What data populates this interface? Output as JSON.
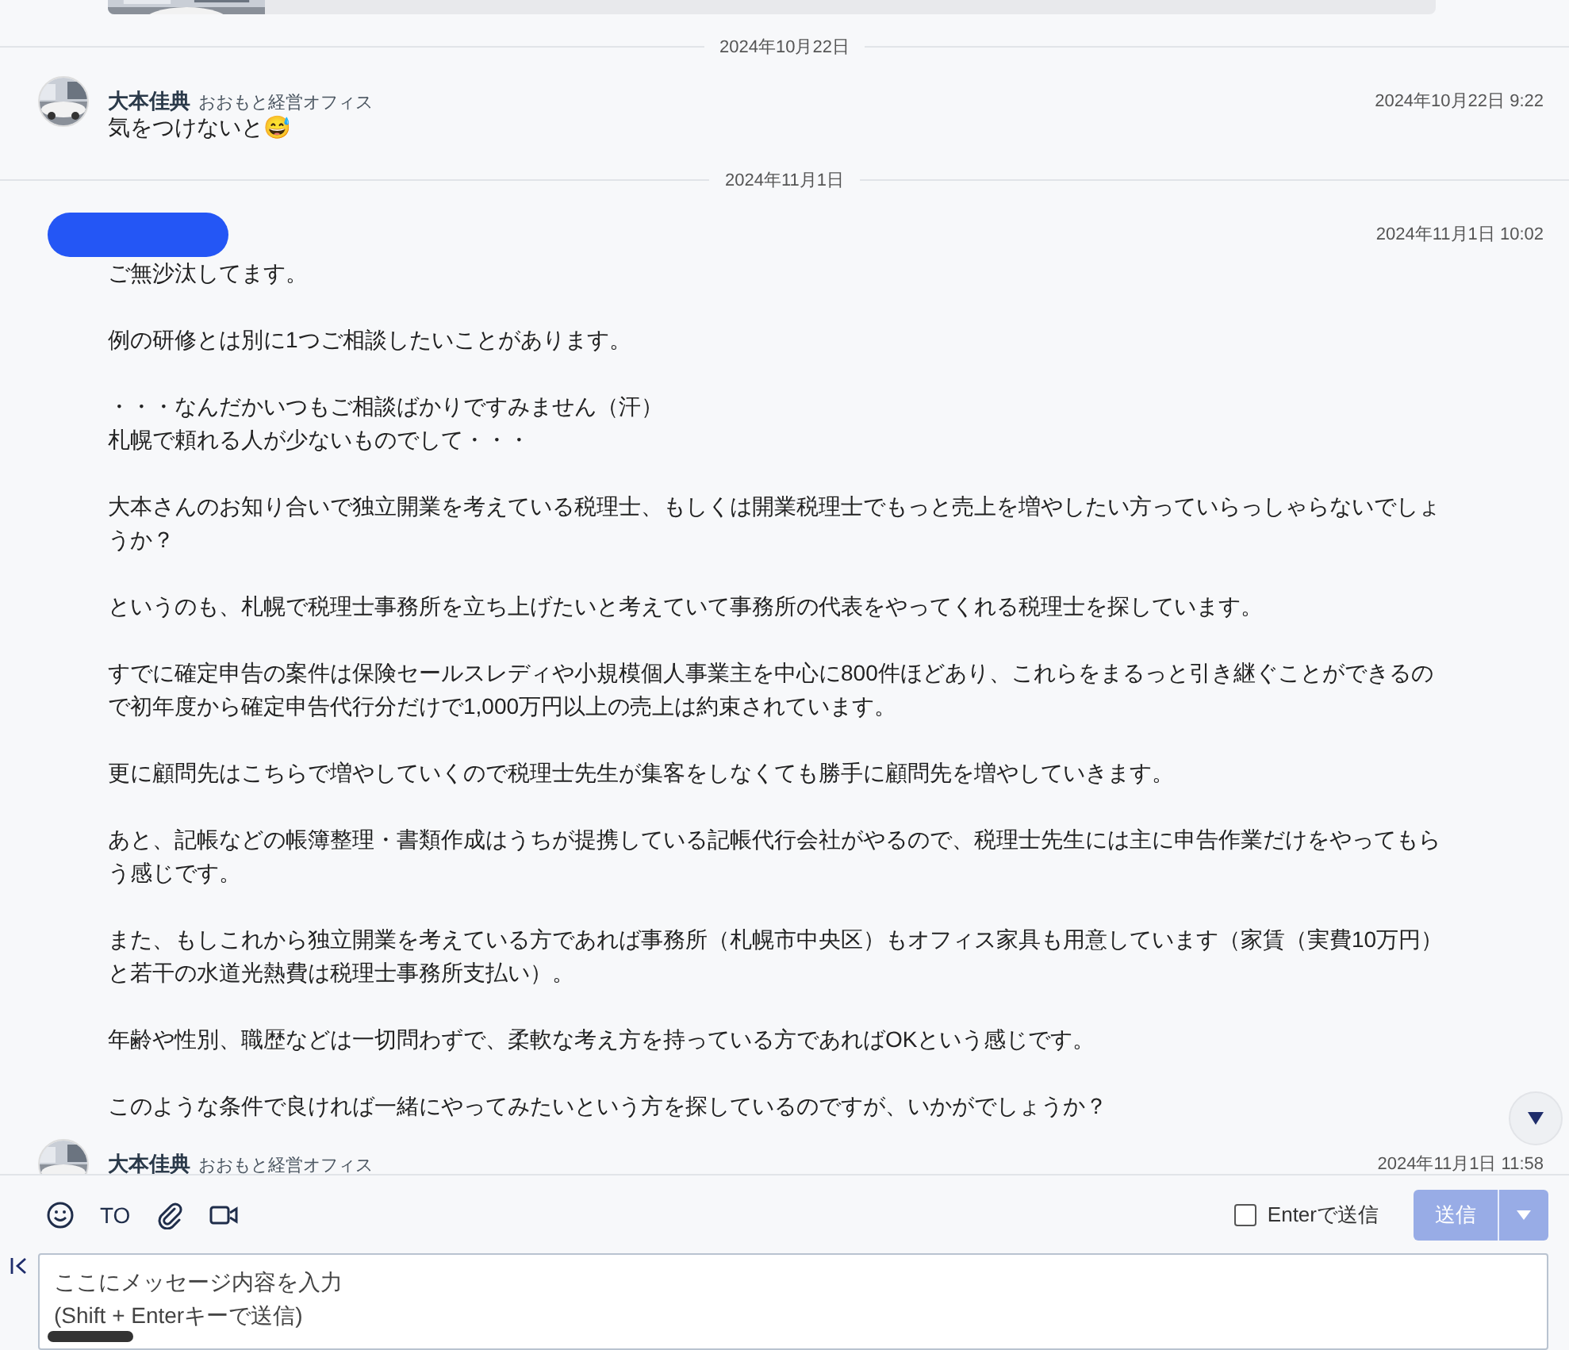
{
  "timeline": [
    {
      "kind": "date",
      "text": "2024年10月22日"
    },
    {
      "kind": "message",
      "redacted": false,
      "name": "大本佳典",
      "org": "おおもと経営オフィス",
      "time": "2024年10月22日 9:22",
      "paragraphs": [
        [
          "気をつけないと😅"
        ]
      ]
    },
    {
      "kind": "date",
      "text": "2024年11月1日"
    },
    {
      "kind": "message",
      "redacted": true,
      "time": "2024年11月1日 10:02",
      "paragraphs": [
        [
          "ご無沙汰してます。"
        ],
        [
          "例の研修とは別に1つご相談したいことがあります。"
        ],
        [
          "・・・なんだかいつもご相談ばかりですみません（汗）",
          "札幌で頼れる人が少ないものでして・・・"
        ],
        [
          "大本さんのお知り合いで独立開業を考えている税理士、もしくは開業税理士でもっと売上を増やしたい方っていらっしゃらないでしょうか？"
        ],
        [
          "というのも、札幌で税理士事務所を立ち上げたいと考えていて事務所の代表をやってくれる税理士を探しています。"
        ],
        [
          "すでに確定申告の案件は保険セールスレディや小規模個人事業主を中心に800件ほどあり、これらをまるっと引き継ぐことができるので初年度から確定申告代行分だけで1,000万円以上の売上は約束されています。"
        ],
        [
          "更に顧問先はこちらで増やしていくので税理士先生が集客をしなくても勝手に顧問先を増やしていきます。"
        ],
        [
          "あと、記帳などの帳簿整理・書類作成はうちが提携している記帳代行会社がやるので、税理士先生には主に申告作業だけをやってもらう感じです。"
        ],
        [
          "また、もしこれから独立開業を考えている方であれば事務所（札幌市中央区）もオフィス家具も用意しています（家賃（実費10万円）と若干の水道光熱費は税理士事務所支払い）。"
        ],
        [
          "年齢や性別、職歴などは一切問わずで、柔軟な考え方を持っている方であればOKという感じです。"
        ],
        [
          "このような条件で良ければ一緒にやってみたいという方を探しているのですが、いかがでしょうか？"
        ]
      ]
    },
    {
      "kind": "message",
      "redacted": false,
      "name": "大本佳典",
      "org": "おおもと経営オフィス",
      "time": "2024年11月1日 11:58"
    }
  ],
  "composer": {
    "tools": [
      {
        "kind": "emoji"
      },
      {
        "kind": "text",
        "label": "TO"
      },
      {
        "kind": "attach"
      },
      {
        "kind": "video"
      }
    ],
    "enter_to_send": {
      "label": "Enterで送信",
      "checked": false
    },
    "send_button": {
      "label": "送信",
      "disabled": true
    },
    "placeholder": "ここにメッセージ内容を入力\n(Shift + Enterキーで送信)"
  }
}
